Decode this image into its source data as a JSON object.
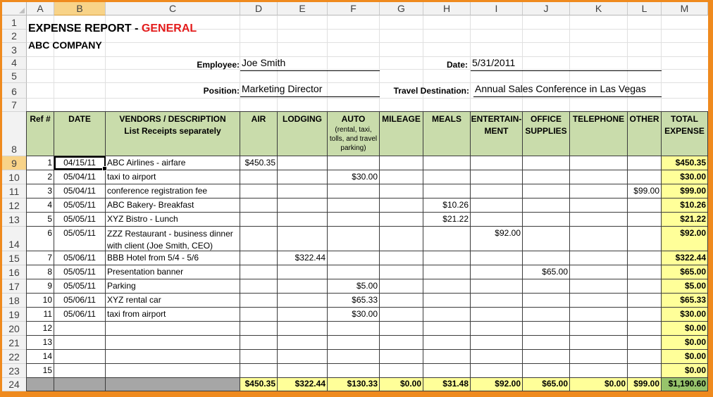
{
  "columns": [
    "A",
    "B",
    "C",
    "D",
    "E",
    "F",
    "G",
    "H",
    "I",
    "J",
    "K",
    "L",
    "M"
  ],
  "rows": [
    "1",
    "2",
    "3",
    "4",
    "5",
    "6",
    "7",
    "8",
    "9",
    "10",
    "11",
    "12",
    "13",
    "14",
    "15",
    "16",
    "17",
    "18",
    "19",
    "20",
    "21",
    "22",
    "23",
    "24"
  ],
  "title": {
    "main": "EXPENSE REPORT - ",
    "accent": "GENERAL"
  },
  "company": "ABC COMPANY",
  "form": {
    "employee_label": "Employee:",
    "employee": "Joe Smith",
    "date_label": "Date:",
    "date": "5/31/2011",
    "position_label": "Position:",
    "position": "Marketing Director",
    "destination_label": "Travel Destination:",
    "destination": "Annual Sales Conference in Las Vegas"
  },
  "headers": {
    "ref": "Ref #",
    "date": "DATE",
    "vendor": "VENDORS / DESCRIPTION",
    "vendor_sub": "List Receipts separately",
    "air": "AIR",
    "lodging": "LODGING",
    "auto": "AUTO",
    "auto_sub": "(rental, taxi, tolls, and travel parking)",
    "mileage": "MILEAGE",
    "meals": "MEALS",
    "entertainment": "ENTERTAIN-MENT",
    "office": "OFFICE SUPPLIES",
    "telephone": "TELEPHONE",
    "other": "OTHER",
    "total": "TOTAL EXPENSE"
  },
  "entries": [
    {
      "ref": "1",
      "date": "04/15/11",
      "desc": "ABC Airlines - airfare",
      "air": "$450.35",
      "lodging": "",
      "auto": "",
      "mileage": "",
      "meals": "",
      "ent": "",
      "office": "",
      "tel": "",
      "other": "",
      "total": "$450.35"
    },
    {
      "ref": "2",
      "date": "05/04/11",
      "desc": " taxi to airport",
      "air": "",
      "lodging": "",
      "auto": "$30.00",
      "mileage": "",
      "meals": "",
      "ent": "",
      "office": "",
      "tel": "",
      "other": "",
      "total": "$30.00"
    },
    {
      "ref": "3",
      "date": "05/04/11",
      "desc": "conference registration fee",
      "air": "",
      "lodging": "",
      "auto": "",
      "mileage": "",
      "meals": "",
      "ent": "",
      "office": "",
      "tel": "",
      "other": "$99.00",
      "total": "$99.00"
    },
    {
      "ref": "4",
      "date": "05/05/11",
      "desc": "ABC Bakery- Breakfast",
      "air": "",
      "lodging": "",
      "auto": "",
      "mileage": "",
      "meals": "$10.26",
      "ent": "",
      "office": "",
      "tel": "",
      "other": "",
      "total": "$10.26"
    },
    {
      "ref": "5",
      "date": "05/05/11",
      "desc": "XYZ Bistro - Lunch",
      "air": "",
      "lodging": "",
      "auto": "",
      "mileage": "",
      "meals": "$21.22",
      "ent": "",
      "office": "",
      "tel": "",
      "other": "",
      "total": "$21.22"
    },
    {
      "ref": "6",
      "date": "05/05/11",
      "desc": "ZZZ Restaurant - business dinner",
      "desc2": "with client (Joe Smith, CEO)",
      "air": "",
      "lodging": "",
      "auto": "",
      "mileage": "",
      "meals": "",
      "ent": "$92.00",
      "office": "",
      "tel": "",
      "other": "",
      "total": "$92.00"
    },
    {
      "ref": "7",
      "date": "05/06/11",
      "desc": "BBB Hotel from 5/4 - 5/6",
      "air": "",
      "lodging": "$322.44",
      "auto": "",
      "mileage": "",
      "meals": "",
      "ent": "",
      "office": "",
      "tel": "",
      "other": "",
      "total": "$322.44"
    },
    {
      "ref": "8",
      "date": "05/05/11",
      "desc": "Presentation banner",
      "air": "",
      "lodging": "",
      "auto": "",
      "mileage": "",
      "meals": "",
      "ent": "",
      "office": "$65.00",
      "tel": "",
      "other": "",
      "total": "$65.00"
    },
    {
      "ref": "9",
      "date": "05/05/11",
      "desc": "Parking",
      "air": "",
      "lodging": "",
      "auto": "$5.00",
      "mileage": "",
      "meals": "",
      "ent": "",
      "office": "",
      "tel": "",
      "other": "",
      "total": "$5.00"
    },
    {
      "ref": "10",
      "date": "05/06/11",
      "desc": "XYZ rental car",
      "air": "",
      "lodging": "",
      "auto": "$65.33",
      "mileage": "",
      "meals": "",
      "ent": "",
      "office": "",
      "tel": "",
      "other": "",
      "total": "$65.33"
    },
    {
      "ref": "11",
      "date": "05/06/11",
      "desc": "taxi from airport",
      "air": "",
      "lodging": "",
      "auto": "$30.00",
      "mileage": "",
      "meals": "",
      "ent": "",
      "office": "",
      "tel": "",
      "other": "",
      "total": "$30.00"
    },
    {
      "ref": "12",
      "date": "",
      "desc": "",
      "air": "",
      "lodging": "",
      "auto": "",
      "mileage": "",
      "meals": "",
      "ent": "",
      "office": "",
      "tel": "",
      "other": "",
      "total": "$0.00"
    },
    {
      "ref": "13",
      "date": "",
      "desc": "",
      "air": "",
      "lodging": "",
      "auto": "",
      "mileage": "",
      "meals": "",
      "ent": "",
      "office": "",
      "tel": "",
      "other": "",
      "total": "$0.00"
    },
    {
      "ref": "14",
      "date": "",
      "desc": "",
      "air": "",
      "lodging": "",
      "auto": "",
      "mileage": "",
      "meals": "",
      "ent": "",
      "office": "",
      "tel": "",
      "other": "",
      "total": "$0.00"
    },
    {
      "ref": "15",
      "date": "",
      "desc": "",
      "air": "",
      "lodging": "",
      "auto": "",
      "mileage": "",
      "meals": "",
      "ent": "",
      "office": "",
      "tel": "",
      "other": "",
      "total": "$0.00"
    }
  ],
  "totals": {
    "air": "$450.35",
    "lodging": "$322.44",
    "auto": "$130.33",
    "mileage": "$0.00",
    "meals": "$31.48",
    "ent": "$92.00",
    "office": "$65.00",
    "tel": "$0.00",
    "other": "$99.00",
    "total": "$1,190.60"
  },
  "colors": {
    "header_green": "#c9dcab",
    "total_yellow": "#ffff99",
    "grand_total_green": "#97c36b",
    "title_red": "#e31b1b",
    "frame_orange": "#ef8a1e"
  },
  "selection": {
    "cell": "B9",
    "column": "B",
    "row": "9"
  }
}
